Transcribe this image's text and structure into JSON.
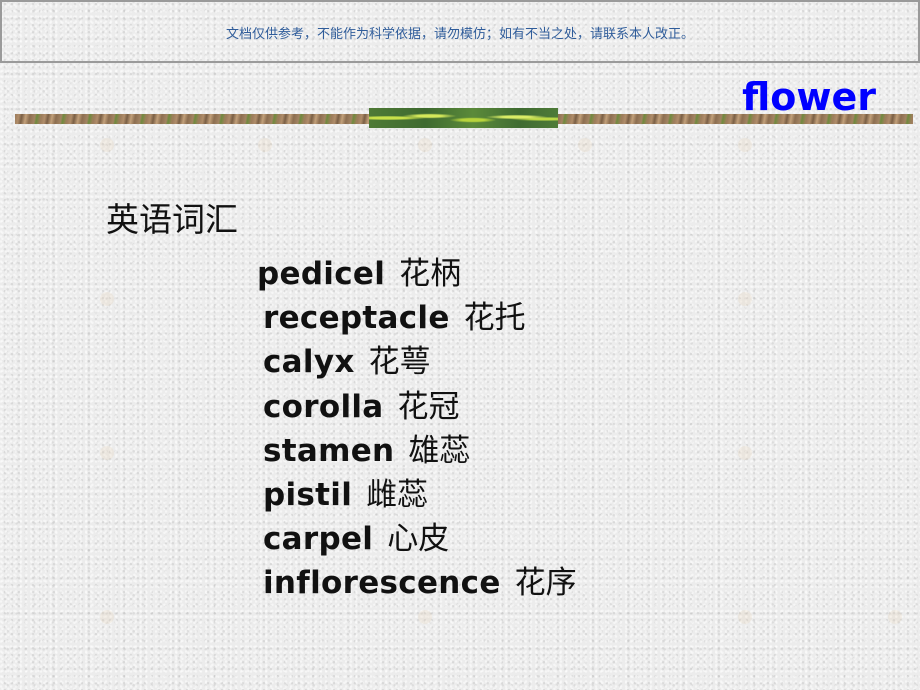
{
  "header": {
    "note": "文档仅供参考，不能作为科学依据，请勿模仿；如有不当之处，请联系本人改正。"
  },
  "slide": {
    "title": "flower",
    "section_heading": "英语词汇",
    "vocabulary": [
      {
        "en": "pedicel",
        "zh": "花柄"
      },
      {
        "en": "receptacle",
        "zh": "花托"
      },
      {
        "en": "calyx",
        "zh": "花萼"
      },
      {
        "en": "corolla",
        "zh": "花冠"
      },
      {
        "en": "stamen",
        "zh": "雄蕊"
      },
      {
        "en": "pistil",
        "zh": "雌蕊"
      },
      {
        "en": "carpel",
        "zh": "心皮"
      },
      {
        "en": "inflorescence",
        "zh": "花序"
      }
    ]
  },
  "colors": {
    "title": "#0000ff",
    "header_note": "#2f5c9a",
    "header_border": "#9a9a9a",
    "body_text": "#111111"
  }
}
